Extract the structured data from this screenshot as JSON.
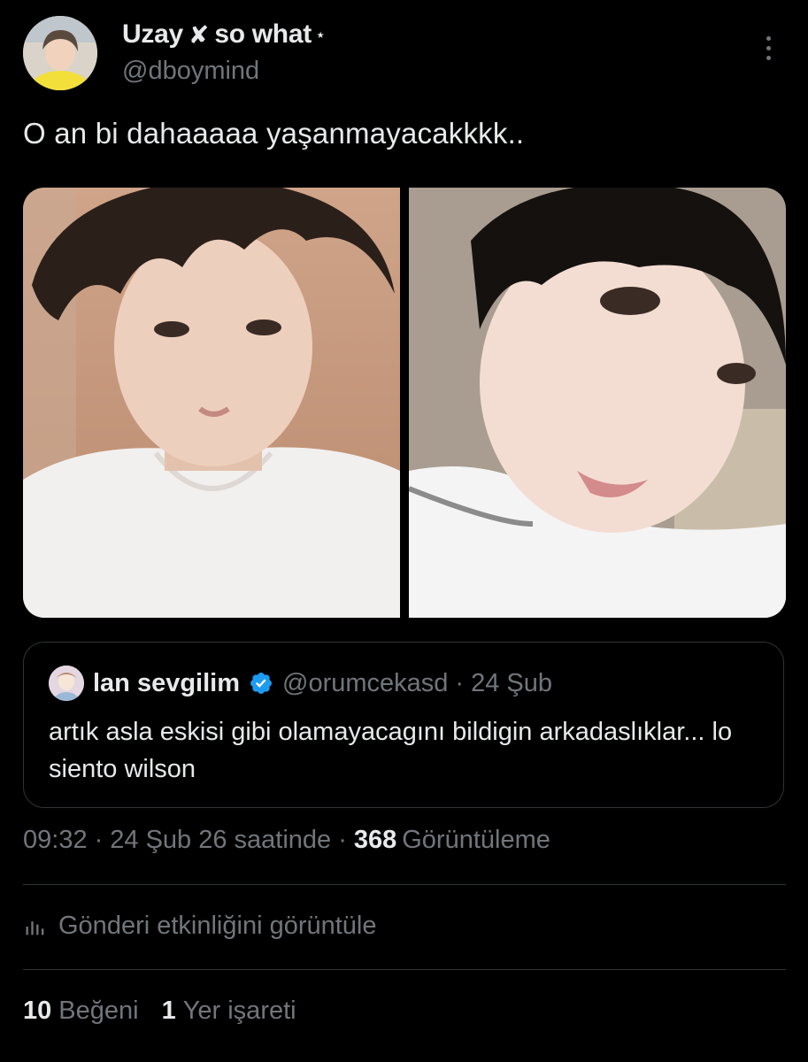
{
  "tweet": {
    "author_name": "Uzay",
    "author_name_suffix": "so what",
    "author_handle": "@dboymind",
    "text": "O an bi dahaaaaa yaşanmayacakkkk..",
    "timestamp": "09:32",
    "date": "24 Şub 26 saatinde",
    "views_count": "368",
    "views_label": "Görüntüleme"
  },
  "quote": {
    "name": "lan sevgilim",
    "handle": "@orumcekasd",
    "date": "24 Şub",
    "text": "artık asla eskisi gibi olamayacagını bildigin arkadaslıklar... lo siento wilson"
  },
  "activity": {
    "label": "Gönderi etkinliğini görüntüle"
  },
  "stats": {
    "likes_count": "10",
    "likes_label": "Beğeni",
    "bookmarks_count": "1",
    "bookmarks_label": "Yer işareti"
  },
  "colors": {
    "background": "#000000",
    "text_primary": "#e7e9ea",
    "text_secondary": "#71767b",
    "border": "#2f3336",
    "verified": "#1d9bf0"
  }
}
